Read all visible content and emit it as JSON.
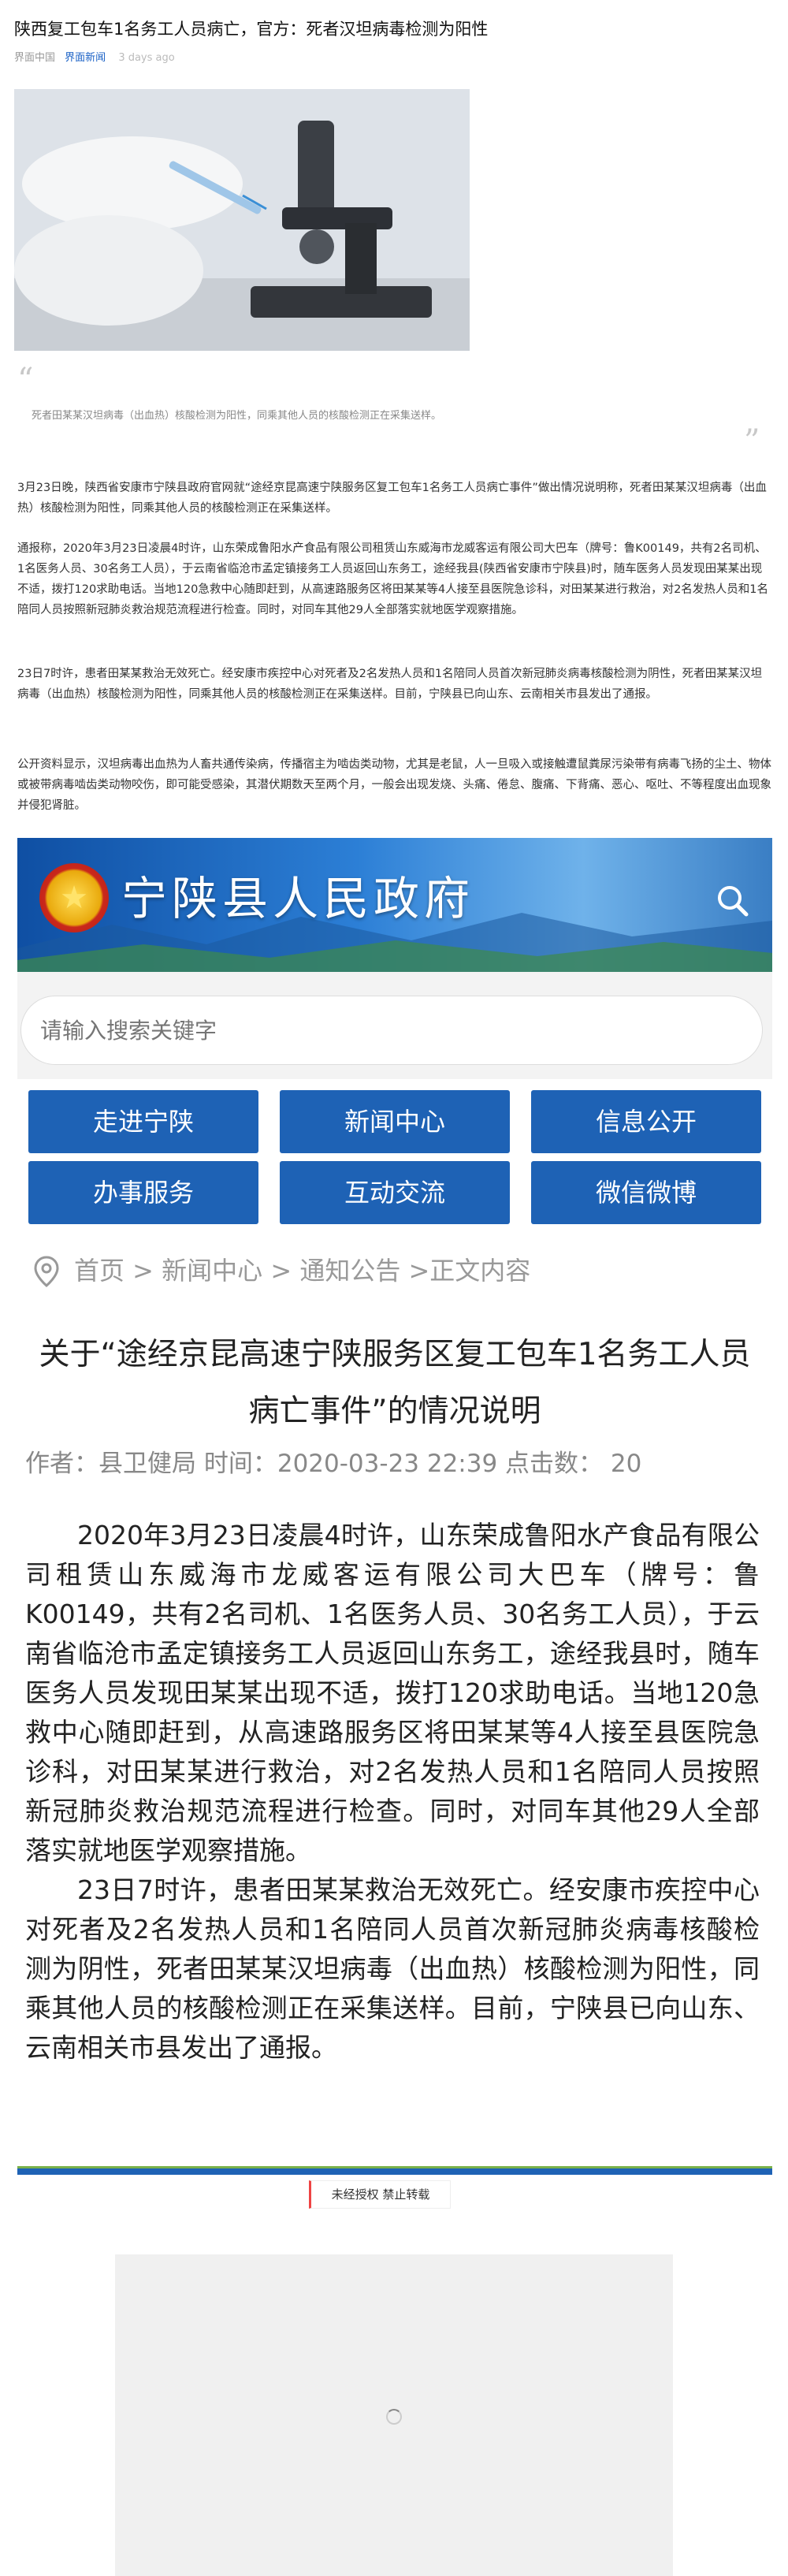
{
  "article": {
    "title": "陕西复工包车1名务工人员病亡，官方：死者汉坦病毒检测为阳性",
    "source": "界面中国",
    "tag": "界面新闻",
    "time": "3 days ago",
    "caption": "死者田某某汉坦病毒（出血热）核酸检测为阳性，同乘其他人员的核酸检测正在采集送样。",
    "paragraphs": [
      "3月23日晚，陕西省安康市宁陕县政府官网就“途经京昆高速宁陕服务区复工包车1名务工人员病亡事件”做出情况说明称，死者田某某汉坦病毒（出血热）核酸检测为阳性，同乘其他人员的核酸检测正在采集送样。",
      "通报称，2020年3月23日凌晨4时许，山东荣成鲁阳水产食品有限公司租赁山东威海市龙威客运有限公司大巴车（牌号：鲁K00149，共有2名司机、1名医务人员、30名务工人员），于云南省临沧市孟定镇接务工人员返回山东务工，途经我县(陕西省安康市宁陕县)时，随车医务人员发现田某某出现不适，拨打120求助电话。当地120急救中心随即赶到，从高速路服务区将田某某等4人接至县医院急诊科，对田某某进行救治，对2名发热人员和1名陪同人员按照新冠肺炎救治规范流程进行检查。同时，对同车其他29人全部落实就地医学观察措施。",
      "23日7时许，患者田某某救治无效死亡。经安康市疾控中心对死者及2名发热人员和1名陪同人员首次新冠肺炎病毒核酸检测为阴性，死者田某某汉坦病毒（出血热）核酸检测为阳性，同乘其他人员的核酸检测正在采集送样。目前，宁陕县已向山东、云南相关市县发出了通报。",
      "公开资料显示，汉坦病毒出血热为人畜共通传染病，传播宿主为啮齿类动物，尤其是老鼠，人一旦吸入或接触遭鼠粪尿污染带有病毒飞扬的尘土、物体或被带病毒啮齿类动物咬伤，即可能受感染，其潜伏期数天至两个月，一般会出现发烧、头痛、倦怠、腹痛、下背痛、恶心、呕吐、不等程度出血现象并侵犯肾脏。"
    ]
  },
  "gov": {
    "site_name": "宁陕县人民政府",
    "search_placeholder": "请输入搜索关键字",
    "nav": [
      "走进宁陕",
      "新闻中心",
      "信息公开",
      "办事服务",
      "互动交流",
      "微信微博"
    ],
    "breadcrumb": "首页 > 新闻中心 > 通知公告 >正文内容",
    "title": "关于“途经京昆高速宁陕服务区复工包车1名务工人员病亡事件”的情况说明",
    "meta": "作者：县卫健局  时间：2020-03-23 22:39  点击数：  20",
    "body": [
      "2020年3月23日凌晨4时许，山东荣成鲁阳水产食品有限公司租赁山东威海市龙威客运有限公司大巴车（牌号：鲁K00149，共有2名司机、1名医务人员、30名务工人员），于云南省临沧市孟定镇接务工人员返回山东务工，途经我县时，随车医务人员发现田某某出现不适，拨打120求助电话。当地120急救中心随即赶到，从高速路服务区将田某某等4人接至县医院急诊科，对田某某进行救治，对2名发热人员和1名陪同人员按照新冠肺炎救治规范流程进行检查。同时，对同车其他29人全部落实就地医学观察措施。",
      "23日7时许，患者田某某救治无效死亡。经安康市疾控中心对死者及2名发热人员和1名陪同人员首次新冠肺炎病毒核酸检测为阴性，死者田某某汉坦病毒（出血热）核酸检测为阳性，同乘其他人员的核酸检测正在采集送样。目前，宁陕县已向山东、云南相关市县发出了通报。"
    ]
  },
  "footer_badge": "未经授权 禁止转载",
  "icons": [
    "quote-open-icon",
    "quote-close-icon",
    "search-icon",
    "location-pin-icon",
    "national-emblem-icon",
    "loading-spinner-icon"
  ],
  "colors": {
    "accent": "#1a61c6",
    "nav_button": "#1e62b5",
    "badge_mark": "#ee4444"
  }
}
